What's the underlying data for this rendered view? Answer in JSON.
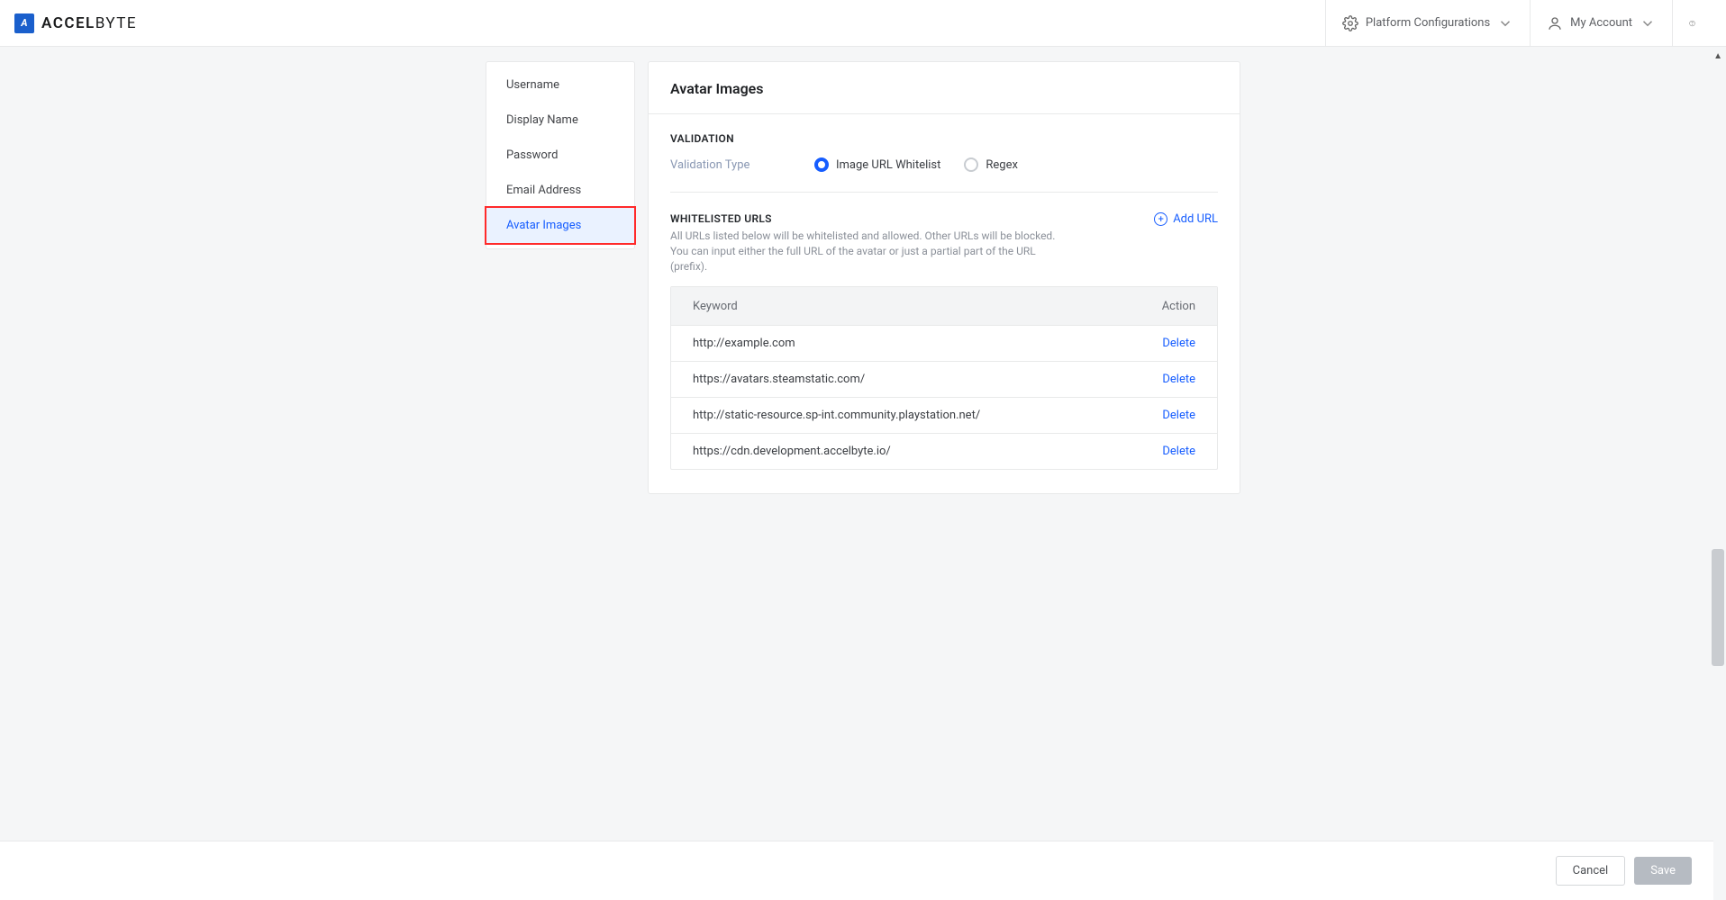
{
  "header": {
    "brand_prefix": "ACCEL",
    "brand_suffix": "BYTE",
    "platform_config_label": "Platform Configurations",
    "my_account_label": "My Account"
  },
  "sidebar": {
    "items": [
      {
        "label": "Username",
        "active": false
      },
      {
        "label": "Display Name",
        "active": false
      },
      {
        "label": "Password",
        "active": false
      },
      {
        "label": "Email Address",
        "active": false
      },
      {
        "label": "Avatar Images",
        "active": true
      }
    ]
  },
  "main": {
    "title": "Avatar Images",
    "validation": {
      "section_title": "VALIDATION",
      "field_label": "Validation Type",
      "options": [
        {
          "label": "Image URL Whitelist",
          "selected": true
        },
        {
          "label": "Regex",
          "selected": false
        }
      ]
    },
    "whitelist": {
      "section_title": "WHITELISTED URLS",
      "description": "All URLs listed below will be whitelisted and allowed. Other URLs will be blocked. You can input either the full URL of the avatar or just a partial part of the URL (prefix).",
      "add_url_label": "Add URL",
      "columns": {
        "keyword_header": "Keyword",
        "action_header": "Action"
      },
      "delete_label": "Delete",
      "rows": [
        {
          "keyword": "http://example.com"
        },
        {
          "keyword": "https://avatars.steamstatic.com/"
        },
        {
          "keyword": "http://static-resource.sp-int.community.playstation.net/"
        },
        {
          "keyword": "https://cdn.development.accelbyte.io/"
        }
      ]
    }
  },
  "footer": {
    "cancel_label": "Cancel",
    "save_label": "Save"
  }
}
